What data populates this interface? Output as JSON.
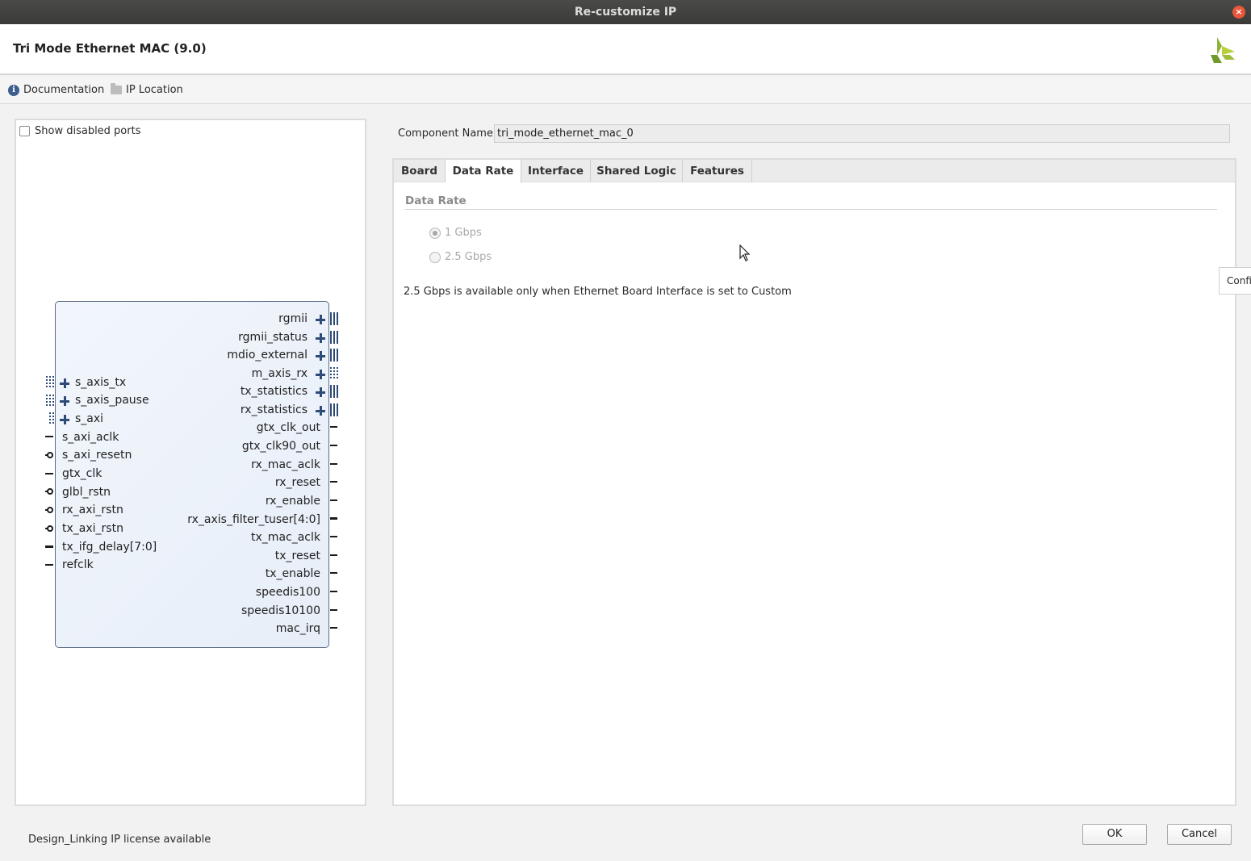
{
  "window": {
    "title": "Re-customize IP",
    "close_glyph": "×"
  },
  "header": {
    "ip_title": "Tri Mode Ethernet MAC (9.0)",
    "logo_icon": "xilinx-logo-icon"
  },
  "toolbar": {
    "documentation": "Documentation",
    "ip_location": "IP Location",
    "info_glyph": "i"
  },
  "left_panel": {
    "show_disabled_ports": "Show disabled ports",
    "show_disabled_checked": false
  },
  "block": {
    "right_ports": [
      "rgmii",
      "rgmii_status",
      "mdio_external",
      "m_axis_rx",
      "tx_statistics",
      "rx_statistics",
      "gtx_clk_out",
      "gtx_clk90_out",
      "rx_mac_aclk",
      "rx_reset",
      "rx_enable",
      "rx_axis_filter_tuser[4:0]",
      "tx_mac_aclk",
      "tx_reset",
      "tx_enable",
      "speedis100",
      "speedis10100",
      "mac_irq"
    ],
    "left_ports": [
      "s_axis_tx",
      "s_axis_pause",
      "s_axi",
      "s_axi_aclk",
      "s_axi_resetn",
      "gtx_clk",
      "glbl_rstn",
      "rx_axi_rstn",
      "tx_axi_rstn",
      "tx_ifg_delay[7:0]",
      "refclk"
    ]
  },
  "component": {
    "label": "Component Name",
    "value": "tri_mode_ethernet_mac_0"
  },
  "tabs": [
    "Board",
    "Data Rate",
    "Interface",
    "Shared Logic",
    "Features"
  ],
  "active_tab": "Data Rate",
  "data_rate": {
    "section_title": "Data Rate",
    "options": [
      "1 Gbps",
      "2.5 Gbps"
    ],
    "selected": "1 Gbps",
    "note": "2.5 Gbps is available only when Ethernet Board Interface is set to Custom"
  },
  "tooltip": {
    "text": "Confi"
  },
  "footer": {
    "license_text": "Design_Linking IP license available",
    "ok_label": "OK",
    "cancel_label": "Cancel"
  },
  "colors": {
    "accent_block": "#e7eef8",
    "bus_blue": "#2e4b78",
    "title_bar": "#3a3a38",
    "close_button": "#e8573a"
  }
}
